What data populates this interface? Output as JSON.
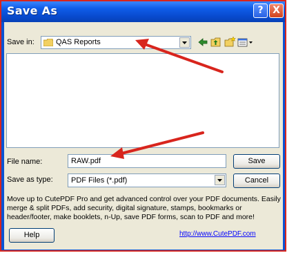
{
  "window": {
    "title": "Save As",
    "help_glyph": "?",
    "close_glyph": "X"
  },
  "save_in": {
    "label": "Save in:",
    "value": "QAS Reports",
    "icon": "folder-icon"
  },
  "toolbar": {
    "icons": [
      "back-arrow-icon",
      "up-folder-icon",
      "new-folder-icon",
      "view-menu-icon"
    ]
  },
  "file_name": {
    "label": "File name:",
    "value": "RAW.pdf"
  },
  "save_as_type": {
    "label": "Save as type:",
    "value": "PDF Files (*.pdf)"
  },
  "buttons": {
    "save": "Save",
    "cancel": "Cancel",
    "help": "Help"
  },
  "promo": {
    "text": "Move up to CutePDF Pro and get advanced control over your PDF documents. Easily merge & split PDFs, add security, digital signature, stamps, bookmarks or header/footer, make booklets, n-Up, save PDF forms, scan to PDF and more!",
    "link": "http://www.CutePDF.com"
  },
  "colors": {
    "annotation_arrow": "#d8251d",
    "title_bar": "#0a53d4",
    "dialog_face": "#ece9d8",
    "link": "#0000ff"
  }
}
